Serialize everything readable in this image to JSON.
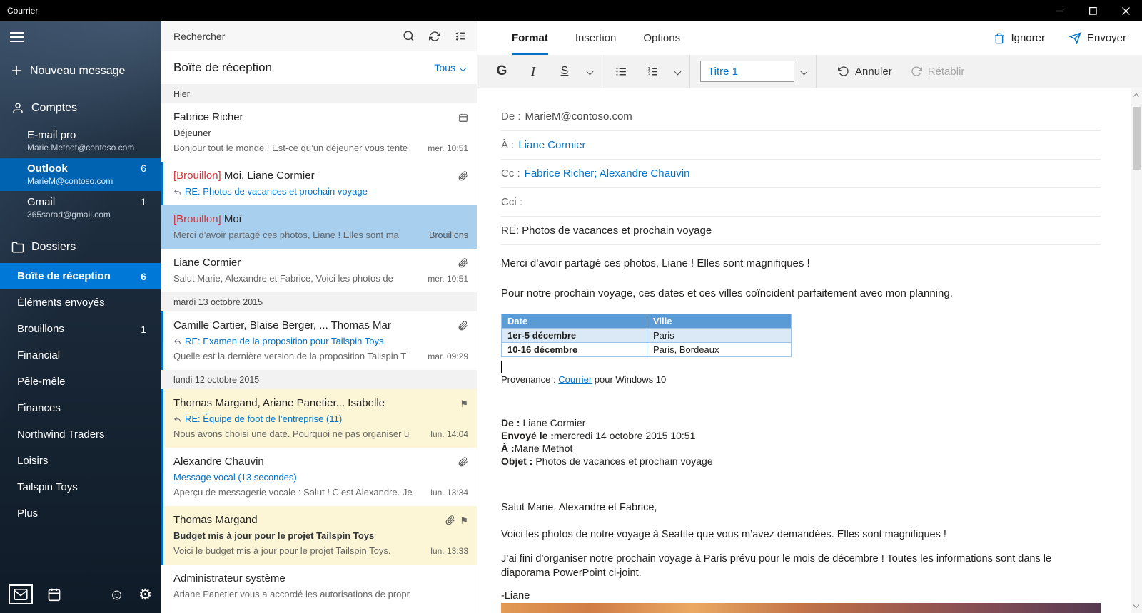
{
  "titlebar": {
    "app_name": "Courrier"
  },
  "icons": {
    "flag": "⚑",
    "smiley": "☺",
    "gear": "⚙"
  },
  "sidebar": {
    "new_message": "Nouveau message",
    "accounts_header": "Comptes",
    "accounts": [
      {
        "name": "E-mail pro",
        "email": "Marie.Methot@contoso.com",
        "badge": ""
      },
      {
        "name": "Outlook",
        "email": "MarieM@contoso.com",
        "badge": "6"
      },
      {
        "name": "Gmail",
        "email": "365sarad@gmail.com",
        "badge": "1"
      }
    ],
    "folders_header": "Dossiers",
    "folders": [
      {
        "name": "Boîte de réception",
        "badge": "6"
      },
      {
        "name": "Éléments envoyés",
        "badge": ""
      },
      {
        "name": "Brouillons",
        "badge": "1"
      },
      {
        "name": "Financial",
        "badge": ""
      },
      {
        "name": "Pêle-mêle",
        "badge": ""
      },
      {
        "name": "Finances",
        "badge": ""
      },
      {
        "name": "Northwind Traders",
        "badge": ""
      },
      {
        "name": "Loisirs",
        "badge": ""
      },
      {
        "name": "Tailspin Toys",
        "badge": ""
      },
      {
        "name": "Plus",
        "badge": ""
      }
    ]
  },
  "list": {
    "search_placeholder": "Rechercher",
    "title": "Boîte de réception",
    "filter_label": "Tous",
    "groups": [
      {
        "label": "Hier",
        "items": [
          {
            "sender": "Fabrice Richer",
            "subject": "Déjeuner",
            "preview": "Bonjour tout le monde ! Est-ce qu’un déjeuner vous tente",
            "date": "mer. 10:51"
          },
          {
            "prefix": "[Brouillon]",
            "sender": " Moi, Liane Cormier",
            "subject": "RE: Photos de vacances et prochain voyage"
          },
          {
            "prefix": "[Brouillon]",
            "sender": " Moi",
            "preview": "Merci d’avoir partagé ces photos, Liane ! Elles sont ma",
            "folder_label": "Brouillons"
          },
          {
            "sender": "Liane Cormier",
            "preview": "Salut Marie, Alexandre et Fabrice, Voici les photos de",
            "date": "mer. 10:51"
          }
        ]
      },
      {
        "label": "mardi 13 octobre 2015",
        "items": [
          {
            "sender": "Camille Cartier, Blaise Berger, ... Thomas Mar",
            "subject": "RE: Examen de la proposition pour Tailspin Toys",
            "preview": "Quelle est la dernière version de la proposition Tailspin T",
            "date": "mar. 09:29"
          }
        ]
      },
      {
        "label": "lundi 12 octobre 2015",
        "items": [
          {
            "sender": "Thomas Margand, Ariane Panetier... Isabelle",
            "subject": "RE: Équipe de foot de l’entreprise (11)",
            "preview": "Nous avons choisi une date. Pourquoi ne pas organiser u",
            "date": "lun. 14:04"
          },
          {
            "sender": "Alexandre Chauvin",
            "subject": "Message vocal (13 secondes)",
            "preview": "Aperçu de messagerie vocale : Salut ! C’est Alexandre. Je",
            "date": "lun. 13:34"
          },
          {
            "sender": "Thomas Margand",
            "subject": "Budget mis à jour pour le projet Tailspin Toys",
            "preview": "Voici le budget mis à jour pour le projet Tailspin Toys.",
            "date": "lun. 13:33"
          },
          {
            "sender": "Administrateur système",
            "preview": "Ariane Panetier vous a accordé les autorisations de propr"
          }
        ]
      }
    ]
  },
  "compose": {
    "tabs": [
      {
        "label": "Format"
      },
      {
        "label": "Insertion"
      },
      {
        "label": "Options"
      }
    ],
    "actions": {
      "discard": "Ignorer",
      "send": "Envoyer"
    },
    "toolbar": {
      "bold": "G",
      "italic": "I",
      "underline": "S",
      "style": "Titre 1",
      "undo": "Annuler",
      "redo": "Rétablir"
    },
    "fields": {
      "from_label": "De :",
      "from_value": "MarieM@contoso.com",
      "to_label": "À :",
      "to_value": "Liane Cormier",
      "cc_label": "Cc :",
      "cc_value": "Fabrice Richer; Alexandre Chauvin",
      "bcc_label": "Cci :",
      "subject": "RE: Photos de vacances et prochain voyage"
    },
    "body": {
      "p1": "Merci d’avoir partagé ces photos, Liane ! Elles sont magnifiques !",
      "p2": "Pour notre prochain voyage, ces dates et ces villes coïncident parfaitement avec mon planning.",
      "table": {
        "headers": [
          "Date",
          "Ville"
        ],
        "rows": [
          [
            "1er-5 décembre",
            "Paris"
          ],
          [
            "10-16 décembre",
            "Paris, Bordeaux"
          ]
        ]
      },
      "provenance_prefix": "Provenance : ",
      "provenance_link": "Courrier",
      "provenance_suffix": " pour Windows 10",
      "quoted": {
        "from_label": "De :",
        "from_value": "Liane Cormier",
        "sent_label": "Envoyé le :",
        "sent_value": "mercredi 14 octobre 2015 10:51",
        "to_label": "À :",
        "to_value": "Marie Methot",
        "subject_label": "Objet :",
        "subject_value": "Photos de vacances et prochain voyage",
        "greeting": "Salut Marie, Alexandre et Fabrice,",
        "p1": "Voici les photos de notre voyage à Seattle que vous m’avez demandées. Elles sont magnifiques !",
        "p2": "J’ai fini d’organiser notre prochain voyage à Paris prévu pour le mois de décembre ! Toutes les informations sont dans le diaporama PowerPoint ci-joint.",
        "signature": "-Liane"
      }
    }
  },
  "colors": {
    "accent": "#0072c9",
    "selected_row": "#a9cfef",
    "flagged_row": "#fcf6d6",
    "draft_red": "#d13438",
    "table_header": "#5b9bd5"
  }
}
